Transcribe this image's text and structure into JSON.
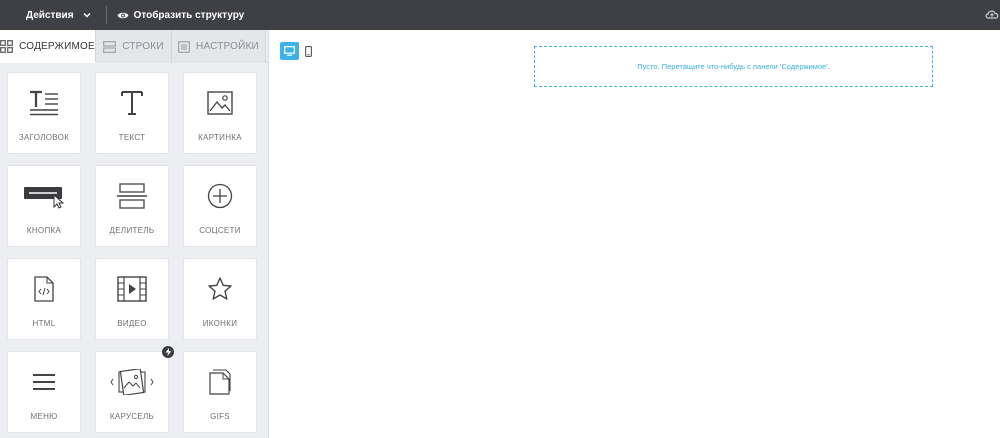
{
  "topbar": {
    "actions_label": "Действия",
    "structure_label": "Отобразить структуру"
  },
  "sidebar": {
    "tabs": [
      {
        "label": "СОДЕРЖИМОЕ",
        "icon": "grid-icon",
        "active": true
      },
      {
        "label": "СТРОКИ",
        "icon": "rows-icon",
        "active": false
      },
      {
        "label": "НАСТРОЙКИ",
        "icon": "settings-icon",
        "active": false
      }
    ],
    "tiles": [
      {
        "label": "ЗАГОЛОВОК",
        "icon": "heading-icon"
      },
      {
        "label": "ТЕКСТ",
        "icon": "text-icon"
      },
      {
        "label": "КАРТИНКА",
        "icon": "image-icon"
      },
      {
        "label": "КНОПКА",
        "icon": "button-icon"
      },
      {
        "label": "ДЕЛИТЕЛЬ",
        "icon": "divider-icon"
      },
      {
        "label": "СОЦСЕТИ",
        "icon": "social-icon"
      },
      {
        "label": "HTML",
        "icon": "html-icon"
      },
      {
        "label": "ВИДЕО",
        "icon": "video-icon"
      },
      {
        "label": "ИКОНКИ",
        "icon": "star-icon"
      },
      {
        "label": "МЕНЮ",
        "icon": "menu-icon"
      },
      {
        "label": "КАРУСЕЛЬ",
        "icon": "carousel-icon"
      },
      {
        "label": "GIFS",
        "icon": "gifs-icon"
      }
    ]
  },
  "main": {
    "view_modes": [
      {
        "name": "desktop",
        "icon": "desktop-icon",
        "active": true
      },
      {
        "name": "mobile",
        "icon": "mobile-icon",
        "active": false
      }
    ],
    "dropzone_text": "Пусто. Перетащите что-нибудь с панели 'Содержимое'."
  },
  "colors": {
    "topbar": "#3f4045",
    "accent": "#3eb2e8",
    "sidebar_bg": "#eceef1"
  }
}
